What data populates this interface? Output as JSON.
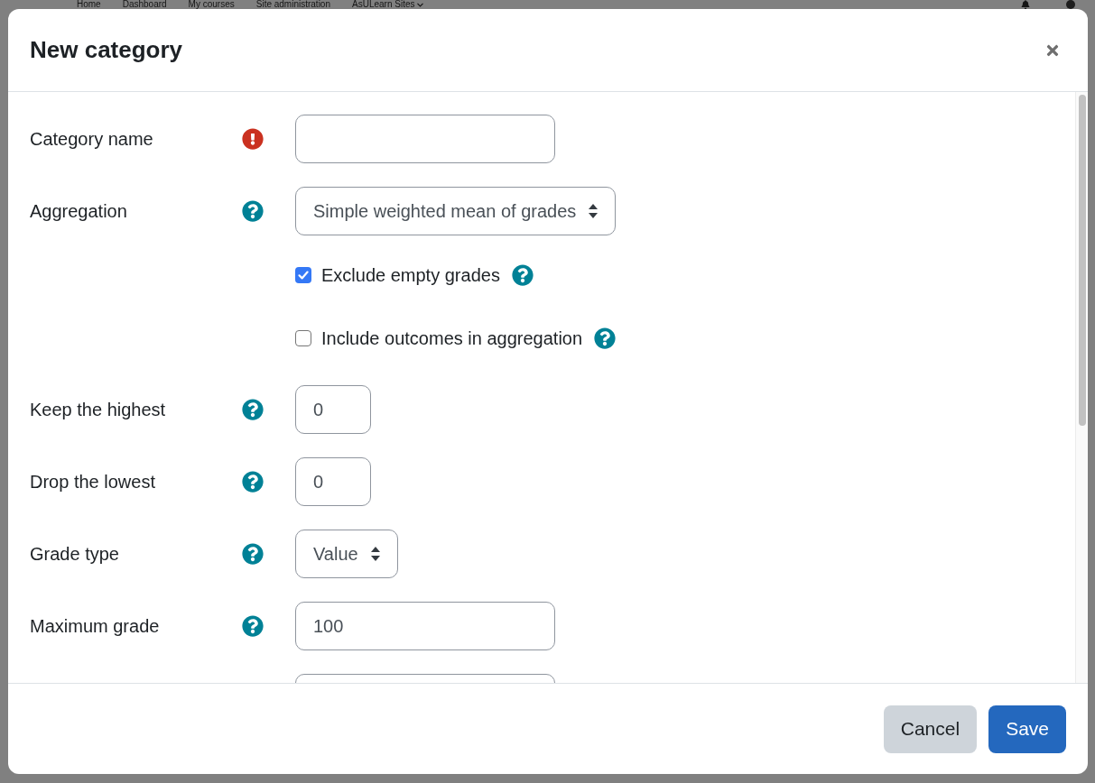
{
  "page_nav": {
    "links": [
      {
        "label": "Home",
        "dropdown": false
      },
      {
        "label": "Dashboard",
        "dropdown": false
      },
      {
        "label": "My courses",
        "dropdown": false
      },
      {
        "label": "Site administration",
        "dropdown": false
      },
      {
        "label": "AsULearn Sites",
        "dropdown": true
      }
    ]
  },
  "dialog": {
    "title": "New category",
    "rows": [
      {
        "kind": "text",
        "label": "Category name",
        "required": true,
        "help": false
      },
      {
        "kind": "select",
        "label": "Aggregation",
        "required": false,
        "help": true,
        "value": "Simple weighted mean of grades"
      },
      {
        "kind": "checkbox",
        "label": "Exclude empty grades",
        "required": false,
        "help": true,
        "checked": true
      },
      {
        "kind": "checkbox",
        "label": "Include outcomes in aggregation",
        "required": false,
        "help": true,
        "checked": false
      },
      {
        "kind": "short-text",
        "label": "Keep the highest",
        "required": false,
        "help": true,
        "value": "0"
      },
      {
        "kind": "short-text",
        "label": "Drop the lowest",
        "required": false,
        "help": true,
        "value": "0"
      },
      {
        "kind": "select",
        "label": "Grade type",
        "required": false,
        "help": true,
        "value": "Value"
      },
      {
        "kind": "text",
        "label": "Maximum grade",
        "required": false,
        "help": true,
        "value": "100"
      },
      {
        "kind": "text",
        "required": false,
        "help": false
      }
    ],
    "buttons": [
      {
        "label": "Cancel",
        "kind": "secondary"
      },
      {
        "label": "Save",
        "kind": "primary"
      }
    ]
  }
}
